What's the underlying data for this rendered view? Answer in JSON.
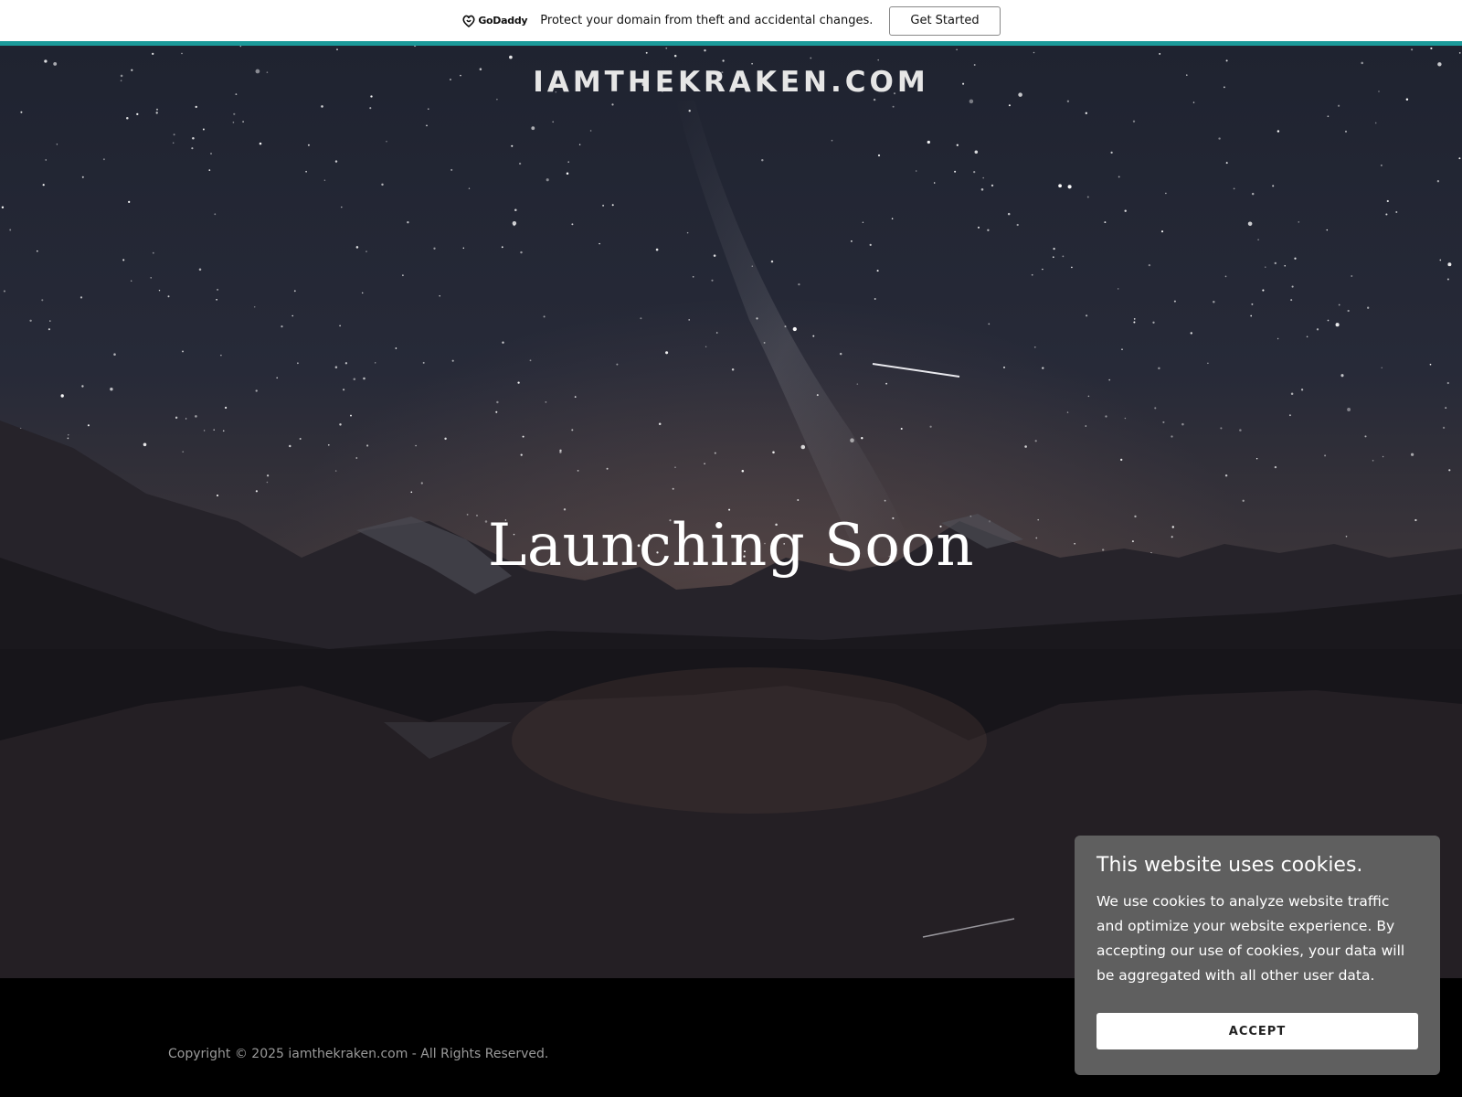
{
  "promo_bar": {
    "logo_text": "GoDaddy",
    "message": "Protect your domain from theft and accidental changes.",
    "cta_label": "Get Started",
    "accent_color": "#1b9a9a"
  },
  "hero": {
    "site_title": "IAMTHEKRAKEN.COM",
    "headline": "Launching Soon"
  },
  "footer": {
    "copyright": "Copyright © 2025 iamthekraken.com - All Rights Reserved."
  },
  "cookie_banner": {
    "title": "This website uses cookies.",
    "body": "We use cookies to analyze website traffic and optimize your website experience. By accepting our use of cookies, your data will be aggregated with all other user data.",
    "accept_label": "ACCEPT"
  }
}
